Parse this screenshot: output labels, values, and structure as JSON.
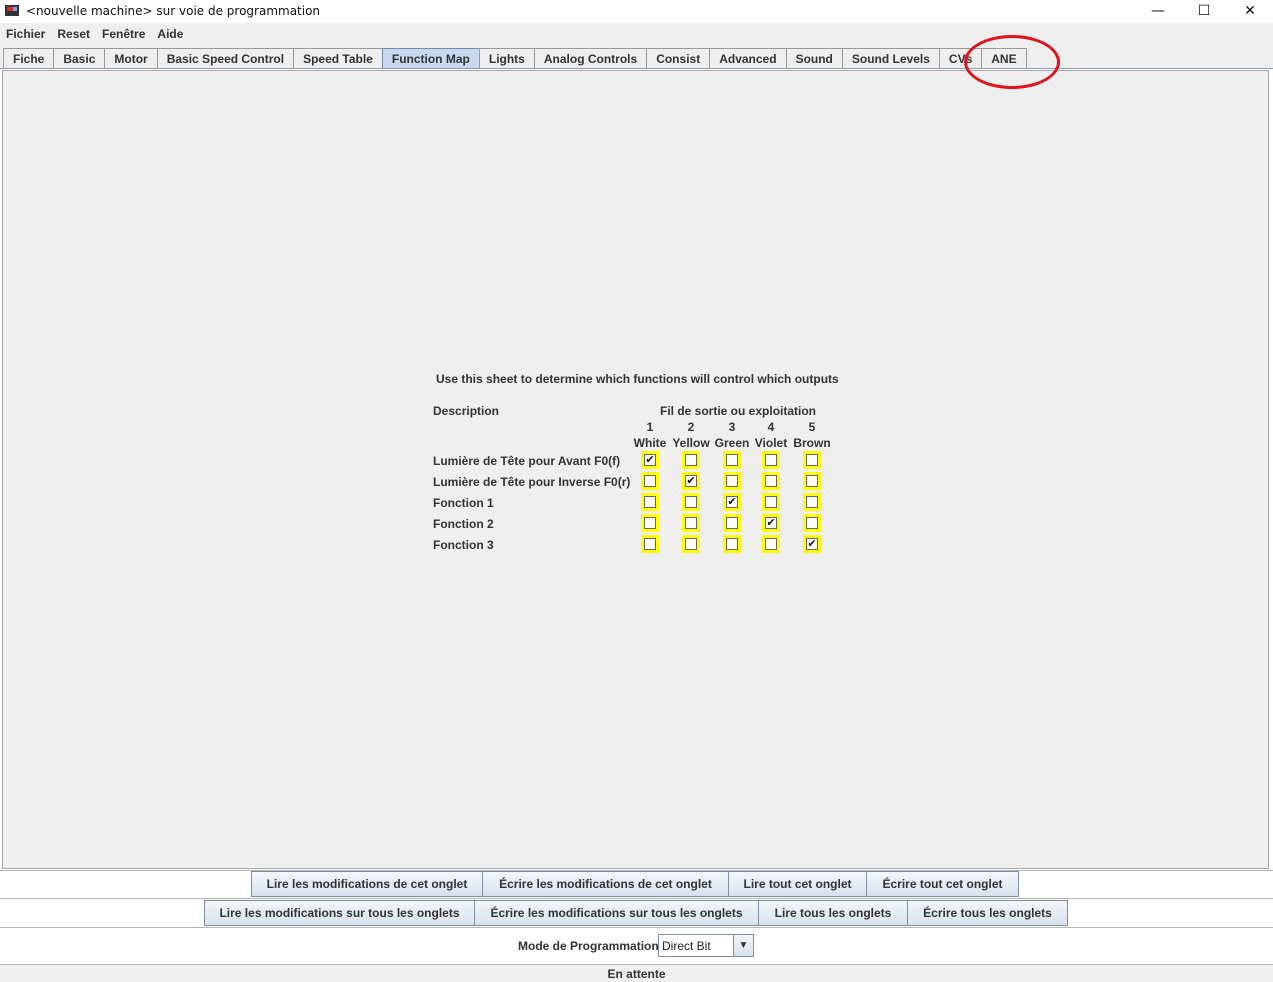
{
  "window": {
    "title": "<nouvelle machine> sur voie de programmation",
    "minimize": "—",
    "maximize": "☐",
    "close": "✕"
  },
  "menu": [
    "Fichier",
    "Reset",
    "Fenêtre",
    "Aide"
  ],
  "tabs": [
    "Fiche",
    "Basic",
    "Motor",
    "Basic Speed Control",
    "Speed Table",
    "Function Map",
    "Lights",
    "Analog Controls",
    "Consist",
    "Advanced",
    "Sound",
    "Sound Levels",
    "CVs",
    "ANE"
  ],
  "active_tab": "Function Map",
  "function_map": {
    "instruction": "Use this sheet to determine which functions will control which outputs",
    "description_header": "Description",
    "outputs_header": "Fil de sortie ou exploitation",
    "columns": [
      {
        "number": "1",
        "color": "White"
      },
      {
        "number": "2",
        "color": "Yellow"
      },
      {
        "number": "3",
        "color": "Green"
      },
      {
        "number": "4",
        "color": "Violet"
      },
      {
        "number": "5",
        "color": "Brown"
      }
    ],
    "rows": [
      {
        "label": "Lumière de Tête pour Avant F0(f)",
        "checked": [
          true,
          false,
          false,
          false,
          false
        ]
      },
      {
        "label": "Lumière de Tête pour Inverse F0(r)",
        "checked": [
          false,
          true,
          false,
          false,
          false
        ]
      },
      {
        "label": "Fonction 1",
        "checked": [
          false,
          false,
          true,
          false,
          false
        ]
      },
      {
        "label": "Fonction 2",
        "checked": [
          false,
          false,
          false,
          true,
          false
        ]
      },
      {
        "label": "Fonction 3",
        "checked": [
          false,
          false,
          false,
          false,
          true
        ]
      }
    ],
    "highlight_color": "#ffff00"
  },
  "buttons_row1": [
    "Lire les modifications de cet onglet",
    "Écrire les modifications de cet onglet",
    "Lire tout cet onglet",
    "Écrire tout cet onglet"
  ],
  "buttons_row2": [
    "Lire les modifications sur tous les onglets",
    "Écrire les modifications sur tous les onglets",
    "Lire tous les onglets",
    "Écrire tous les onglets"
  ],
  "programming_mode": {
    "label": "Mode de Programmation",
    "value": "Direct Bit"
  },
  "status": "En attente",
  "annotation_color": "#e0141c"
}
